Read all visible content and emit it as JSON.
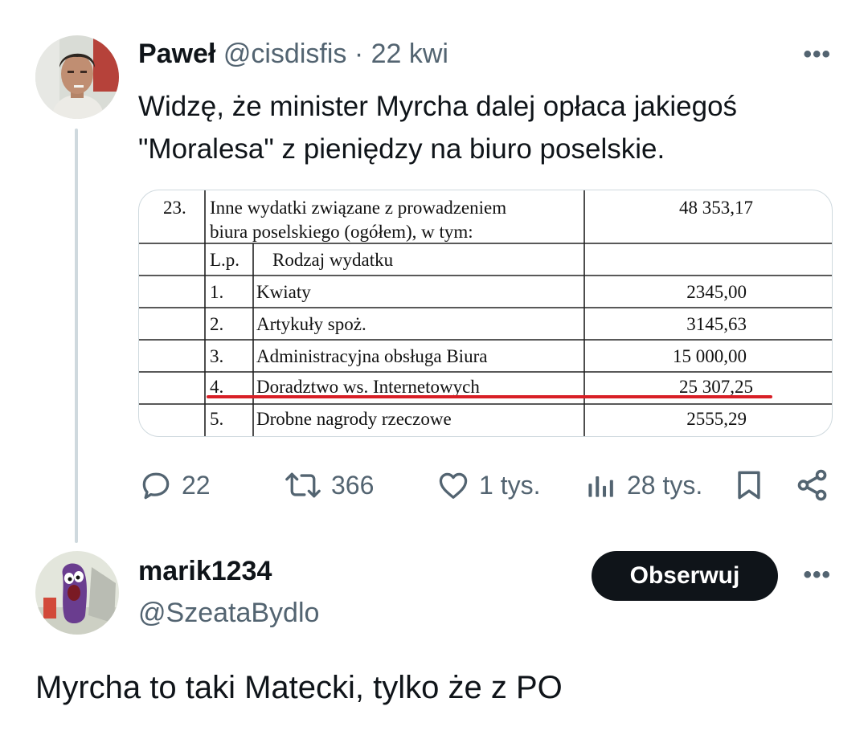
{
  "tweet": {
    "author_name": "Paweł",
    "author_handle": "@cisdisfis",
    "separator": "·",
    "date": "22 kwi",
    "text_lines": [
      "Widzę, że minister Myrcha dalej opłaca jakiegoś",
      "\"Moralesa\" z pieniędzy na biuro poselskie."
    ],
    "more_label": "•••",
    "media_table": {
      "row_num": "23.",
      "row_title_lines": [
        "Inne wydatki związane z prowadzeniem",
        "biura poselskiego (ogółem), w tym:"
      ],
      "row_total": "48 353,17",
      "col_lp": "L.p.",
      "col_type": "Rodzaj wydatku",
      "items": [
        {
          "lp": "1.",
          "name": "Kwiaty",
          "amount": "2345,00"
        },
        {
          "lp": "2.",
          "name": "Artykuły spoż.",
          "amount": "3145,63"
        },
        {
          "lp": "3.",
          "name": "Administracyjna obsługa Biura",
          "amount": "15 000,00"
        },
        {
          "lp": "4.",
          "name": "Doradztwo ws. Internetowych",
          "amount": "25 307,25"
        },
        {
          "lp": "5.",
          "name": "Drobne nagrody rzeczowe",
          "amount": "2555,29"
        }
      ],
      "highlight_color": "#d81f26"
    },
    "actions": {
      "replies": "22",
      "retweets": "366",
      "likes": "1 tys.",
      "views": "28 tys."
    },
    "icons": [
      "reply-icon",
      "retweet-icon",
      "like-icon",
      "views-icon",
      "bookmark-icon",
      "share-icon"
    ]
  },
  "reply": {
    "author_name": "marik1234",
    "author_handle": "@SzeataBydlo",
    "follow_label": "Obserwuj",
    "more_label": "•••",
    "text": "Myrcha to taki Matecki, tylko że z PO"
  },
  "colors": {
    "text": "#0f1419",
    "muted": "#536471",
    "thread_line": "#cfd9de",
    "follow_bg": "#0f1419"
  }
}
